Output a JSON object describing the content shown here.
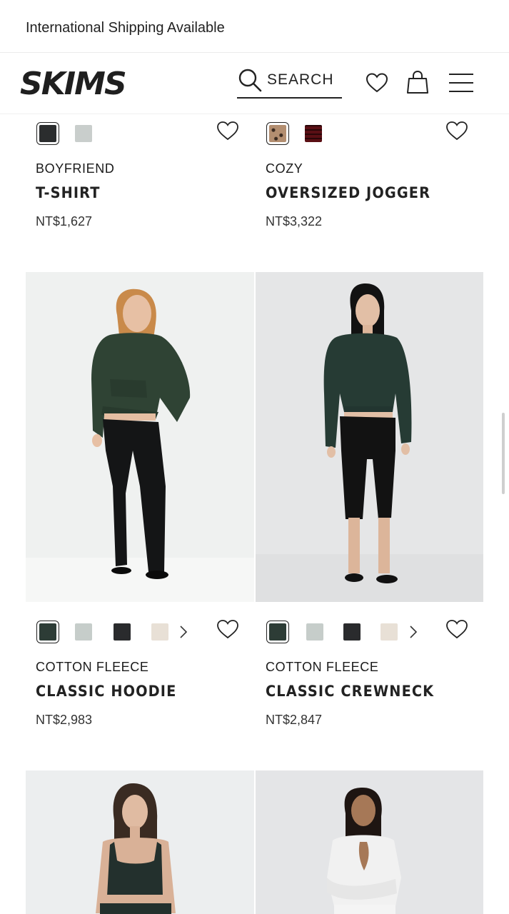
{
  "announcement": "International Shipping Available",
  "header": {
    "logo": "SKIMS",
    "search_label": "SEARCH"
  },
  "products": [
    {
      "subtitle": "BOYFRIEND",
      "title": "T-SHIRT",
      "price": "NT$1,627",
      "swatches": [
        "#2b2d2e",
        "#c9cecc"
      ]
    },
    {
      "subtitle": "COZY",
      "title": "OVERSIZED JOGGER",
      "price": "NT$3,322",
      "swatches": [
        "leopard",
        "#5a0f14"
      ]
    },
    {
      "subtitle": "COTTON FLEECE",
      "title": "CLASSIC HOODIE",
      "price": "NT$2,983",
      "swatches": [
        "#2d3c36",
        "#c6cdca",
        "#2a2b2d",
        "#e8e0d6"
      ]
    },
    {
      "subtitle": "COTTON FLEECE",
      "title": "CLASSIC CREWNECK",
      "price": "NT$2,847",
      "swatches": [
        "#2d3c36",
        "#c6cdca",
        "#2a2b2d",
        "#e8e0d6"
      ]
    }
  ],
  "colors": {
    "text": "#1a1a1a",
    "photo_bg_light": "#f0f1f0",
    "photo_bg_grey": "#e6e7e7",
    "garment_green": "#2e3f34"
  }
}
